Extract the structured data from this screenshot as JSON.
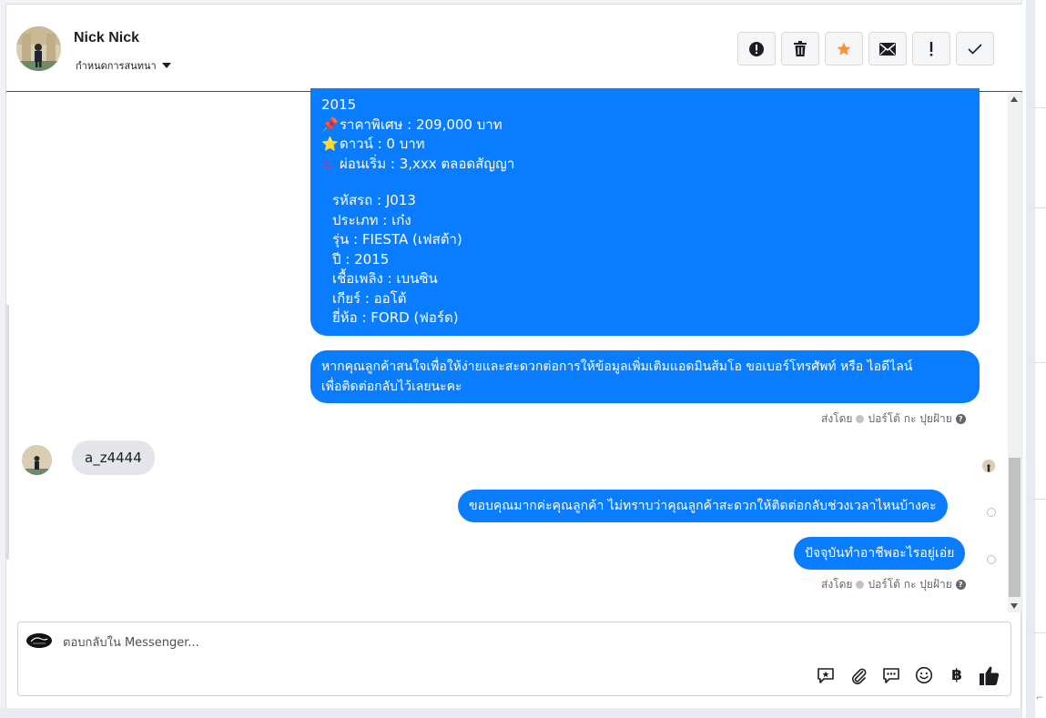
{
  "contact": {
    "name": "Nick Nick",
    "status_label": "กำหนดการสนทนา"
  },
  "header_actions": [
    {
      "icon": "alert-circle-icon"
    },
    {
      "icon": "trash-icon"
    },
    {
      "icon": "star-icon",
      "color": "#f7923b"
    },
    {
      "icon": "envelope-icon"
    },
    {
      "icon": "exclamation-icon"
    },
    {
      "icon": "check-icon"
    }
  ],
  "messages": {
    "listing": {
      "year_top": "2015",
      "price": "ราคาพิเศษ : 209,000 บาท",
      "down": "ดาวน์ : 0 บาท",
      "installment": "ผ่อนเริ่ม : 3,xxx ตลอดสัญญา",
      "code": "รหัสรถ : J013",
      "type": "ประเภท : เก๋ง",
      "model": "รุ่น : FIESTA (เฟสต้า)",
      "year": "ปี : 2015",
      "fuel": "เชื้อเพลิง : เบนซิน",
      "gear": "เกียร์ : ออโต้",
      "brand": "ยี่ห้อ : FORD (ฟอร์ด)"
    },
    "contact_request_line1": "หากคุณลูกค้าสนใจเพื่อให้ง่ายและสะดวกต่อการให้ข้อมูลเพิ่มเติมแอดมินส้มโอ ขอเบอร์โทรศัพท์ หรือ ไอดีไลน์",
    "contact_request_line2": "เพื่อติดต่อกลับไว้เลยนะคะ",
    "incoming": "a_z4444",
    "thanks": "ขอบคุณมากค่ะคุณลูกค้า ไม่ทราบว่าคุณลูกค้าสะดวกให้ติดต่อกลับช่วงเวลาไหนบ้างคะ",
    "job_question": "ปัจจุบันทำอาชีพอะไรอยู่เอ่ย"
  },
  "sent_by": {
    "prefix": "ส่งโดย",
    "agent": "ปอร์โต้ กะ ปุยฝ้าย"
  },
  "composer": {
    "placeholder": "ตอบกลับใน Messenger..."
  },
  "composer_tools": [
    "saved-reply-icon",
    "attachment-icon",
    "chat-icon",
    "emoji-icon",
    "baht-icon",
    "thumbs-up-icon"
  ],
  "colors": {
    "bubble_out": "#0a7cff",
    "bubble_in": "#e4e6eb"
  }
}
